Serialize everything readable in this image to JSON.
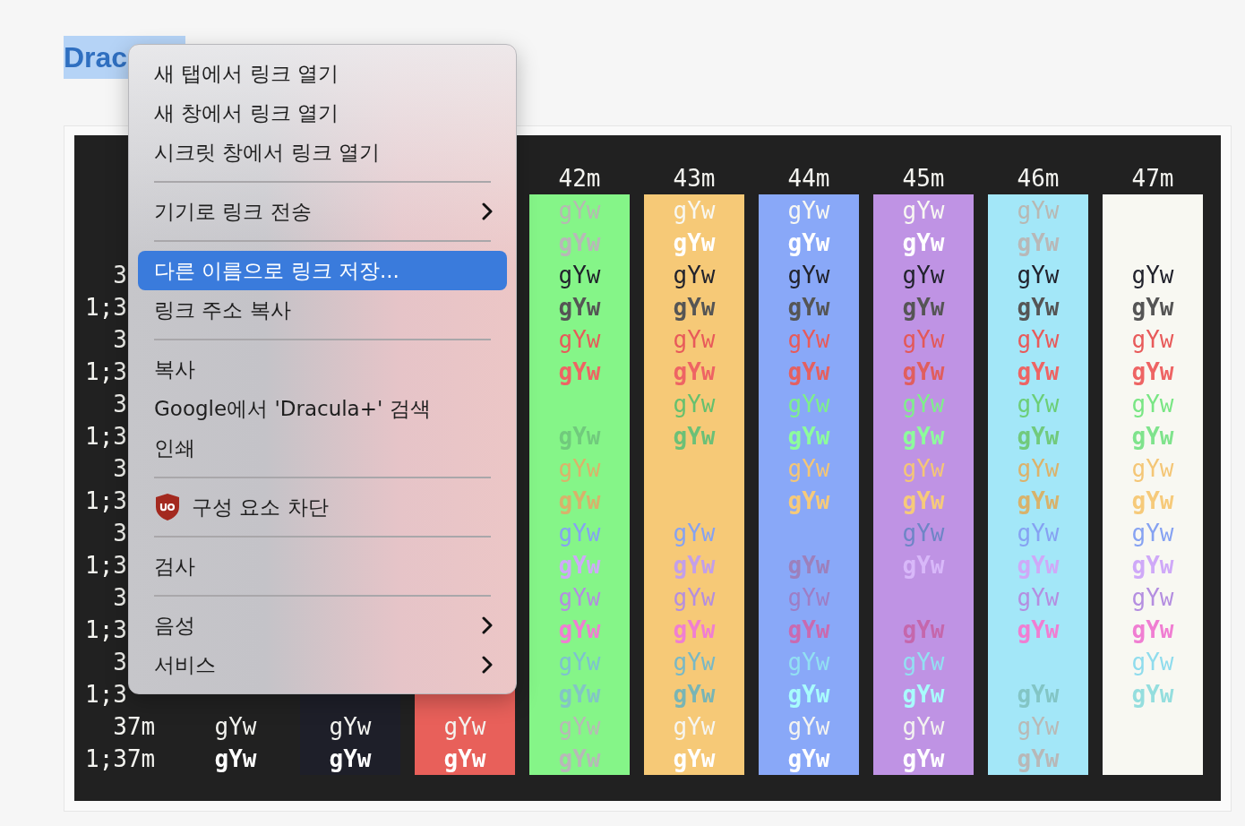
{
  "title": {
    "text": "Drac",
    "selected": true
  },
  "columns": [
    {
      "color": "#212121"
    },
    {
      "color": "#1e1f29"
    },
    {
      "color": "#e8605a"
    },
    {
      "header": "42m",
      "color": "#85f588"
    },
    {
      "header": "43m",
      "color": "#f6c977"
    },
    {
      "header": "44m",
      "color": "#89a8f8"
    },
    {
      "header": "45m",
      "color": "#bf93e4"
    },
    {
      "header": "46m",
      "color": "#a3e7f8"
    },
    {
      "header": "47m",
      "color": "#f8f8f2"
    }
  ],
  "rows": [
    {
      "kind": "plain",
      "color": "#f8f8f2",
      "cells": [
        null,
        null,
        null,
        "gYw",
        "gYw",
        "gYw",
        "gYw",
        "gYw",
        null
      ]
    },
    {
      "kind": "bold",
      "color": "#ffffff",
      "cells": [
        null,
        null,
        null,
        "gYw",
        "gYw",
        "gYw",
        "gYw",
        "gYw",
        null
      ]
    },
    {
      "kind": "plain",
      "label": "3",
      "color": "#21222c",
      "cells": [
        null,
        null,
        null,
        "gYw",
        "gYw",
        "gYw",
        "gYw",
        "gYw",
        "gYw"
      ]
    },
    {
      "kind": "bold",
      "label": "1;3",
      "color": "#555555",
      "cells": [
        null,
        null,
        null,
        "gYw",
        "gYw",
        "gYw",
        "gYw",
        "gYw",
        "gYw"
      ]
    },
    {
      "kind": "plain",
      "label": "3",
      "color": "#e85a5a",
      "cells": [
        null,
        null,
        null,
        "gYw",
        "gYw",
        "gYw",
        "gYw",
        "gYw",
        "gYw"
      ]
    },
    {
      "kind": "bold",
      "label": "1;3",
      "color": "#ee6464",
      "cells": [
        null,
        null,
        null,
        "gYw",
        "gYw",
        "gYw",
        "gYw",
        "gYw",
        "gYw"
      ]
    },
    {
      "kind": "plain",
      "label": "3",
      "color": "#7ef08a",
      "cells": [
        null,
        null,
        null,
        null,
        "gYw",
        "gYw",
        "gYw",
        "gYw",
        "gYw"
      ]
    },
    {
      "kind": "bold",
      "label": "1;3",
      "color": "#8dfc9c",
      "cells": [
        null,
        null,
        null,
        "gYw",
        "gYw",
        "gYw",
        "gYw",
        "gYw",
        "gYw"
      ]
    },
    {
      "kind": "plain",
      "label": "3",
      "color": "#f4c676",
      "cells": [
        null,
        null,
        null,
        "gYw",
        null,
        "gYw",
        "gYw",
        "gYw",
        "gYw"
      ]
    },
    {
      "kind": "bold",
      "label": "1;3",
      "color": "#f6ca7a",
      "cells": [
        null,
        null,
        null,
        "gYw",
        null,
        "gYw",
        "gYw",
        "gYw",
        "gYw"
      ]
    },
    {
      "kind": "plain",
      "label": "3",
      "color": "#86a2f2",
      "cells": [
        null,
        null,
        null,
        "gYw",
        "gYw",
        null,
        "gYw",
        "gYw",
        "gYw"
      ]
    },
    {
      "kind": "bold",
      "label": "1;3",
      "color": "#cfa9f8",
      "cells": [
        null,
        null,
        null,
        "gYw",
        "gYw",
        "gYw",
        "gYw",
        "gYw",
        "gYw"
      ]
    },
    {
      "kind": "plain",
      "label": "3",
      "color": "#b48ee0",
      "cells": [
        null,
        null,
        null,
        "gYw",
        "gYw",
        "gYw",
        null,
        "gYw",
        "gYw"
      ]
    },
    {
      "kind": "bold",
      "label": "1;3",
      "color": "#f07ed2",
      "cells": [
        null,
        null,
        null,
        "gYw",
        "gYw",
        "gYw",
        "gYw",
        "gYw",
        "gYw"
      ]
    },
    {
      "kind": "plain",
      "label": "3",
      "color": "#92e0f2",
      "cells": [
        null,
        null,
        null,
        "gYw",
        "gYw",
        "gYw",
        "gYw",
        null,
        "gYw"
      ]
    },
    {
      "kind": "bold",
      "label": "1;3",
      "color": "#a8fcfc",
      "cells": [
        null,
        null,
        null,
        "gYw",
        "gYw",
        "gYw",
        "gYw",
        "gYw",
        "gYw"
      ]
    },
    {
      "kind": "plain",
      "label": "37m",
      "color": "#f4f4f0",
      "cells": [
        "gYw",
        "gYw",
        "gYw",
        "gYw",
        "gYw",
        "gYw",
        "gYw",
        "gYw",
        null
      ]
    },
    {
      "kind": "bold",
      "label": "1;37m",
      "color": "#ffffff",
      "cells": [
        "gYw",
        "gYw",
        "gYw",
        "gYw",
        "gYw",
        "gYw",
        "gYw",
        "gYw",
        null
      ]
    }
  ],
  "menu": [
    {
      "kind": "item",
      "label": "새 탭에서 링크 열기",
      "selected": false
    },
    {
      "kind": "item",
      "label": "새 창에서 링크 열기",
      "selected": false
    },
    {
      "kind": "item",
      "label": "시크릿 창에서 링크 열기",
      "selected": false
    },
    {
      "kind": "separator"
    },
    {
      "kind": "submenu",
      "label": "기기로 링크 전송",
      "selected": false
    },
    {
      "kind": "separator"
    },
    {
      "kind": "item",
      "label": "다른 이름으로 링크 저장...",
      "selected": true
    },
    {
      "kind": "item",
      "label": "링크 주소 복사",
      "selected": false
    },
    {
      "kind": "separator"
    },
    {
      "kind": "item",
      "label": "복사",
      "selected": false
    },
    {
      "kind": "item",
      "label": "Google에서 'Dracula+' 검색",
      "selected": false
    },
    {
      "kind": "item",
      "label": "인쇄",
      "selected": false
    },
    {
      "kind": "separator"
    },
    {
      "kind": "extension",
      "label": "구성 요소 차단",
      "selected": false
    },
    {
      "kind": "separator"
    },
    {
      "kind": "item",
      "label": "검사",
      "selected": false
    },
    {
      "kind": "separator"
    },
    {
      "kind": "submenu",
      "label": "음성",
      "selected": false
    },
    {
      "kind": "submenu",
      "label": "서비스",
      "selected": false
    }
  ]
}
